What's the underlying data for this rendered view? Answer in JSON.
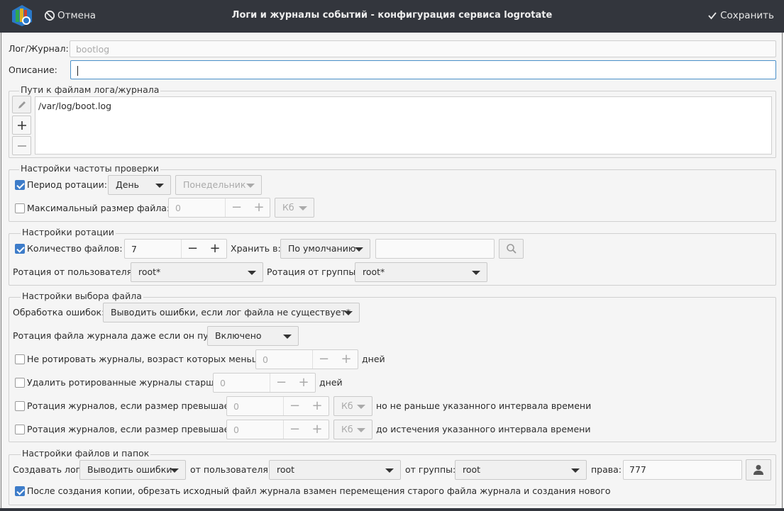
{
  "window": {
    "title": "Логи и журналы событий - конфигурация сервиса logrotate",
    "cancel_label": "Отмена",
    "save_label": "Сохранить"
  },
  "log": {
    "label": "Лог/Журнал:",
    "value": "bootlog",
    "desc_label": "Описание:",
    "desc_value": ""
  },
  "paths": {
    "title": "Пути к файлам лога/журнала",
    "items": [
      "/var/log/boot.log"
    ]
  },
  "freq": {
    "title": "Настройки частоты проверки",
    "period_label": "Период ротации:",
    "period_checked": true,
    "period_value": "День",
    "weekday_value": "Понедельник",
    "maxsize_label": "Максимальный размер файла:",
    "maxsize_checked": false,
    "maxsize_value": "0",
    "maxsize_unit": "Кб"
  },
  "rotation": {
    "title": "Настройки ротации",
    "count_label": "Количество файлов:",
    "count_checked": true,
    "count_value": "7",
    "store_label": "Хранить в:",
    "store_value": "По умолчанию",
    "store_path": "",
    "user_label": "Ротация от пользователя:",
    "user_value": "root*",
    "group_label": "Ротация от группы:",
    "group_value": "root*"
  },
  "select": {
    "title": "Настройки выбора файла",
    "errors_label": "Обработка ошибок:",
    "errors_value": "Выводить ошибки, если лог файла не существует*",
    "empty_label": "Ротация файла журнала даже если он пуст:",
    "empty_value": "Включено",
    "minage_label": "Не ротировать журналы, возраст которых меньше",
    "minage_value": "0",
    "minage_unit": "дней",
    "maxage_label": "Удалить ротированные журналы старше",
    "maxage_value": "0",
    "maxage_unit": "дней",
    "minsize_label": "Ротация журналов, если размер превышает",
    "minsize_value": "0",
    "minsize_unit": "Кб",
    "minsize_suffix": "но не раньше указанного интервала времени",
    "size2_label": "Ротация журналов, если размер превышает",
    "size2_value": "0",
    "size2_unit": "Кб",
    "size2_suffix": "до истечения указанного интервала времени"
  },
  "files": {
    "title": "Настройки файлов и папок",
    "create_label": "Создавать лог",
    "create_value": "Выводить ошибки",
    "user_label": "от пользователя:",
    "user_value": "root",
    "group_label": "от группы:",
    "group_value": "root",
    "perm_label": "права:",
    "perm_value": "777",
    "copytruncate_checked": true,
    "copytruncate_label": "После создания копии, обрезать исходный файл журнала взамен перемещения старого файла журнала и создания нового"
  },
  "icons": {
    "app": "logrotate-app-icon",
    "cancel": "cancel-circle-icon",
    "save": "checkmark-icon",
    "edit": "pencil-icon",
    "add": "plus-icon",
    "remove": "minus-icon",
    "browse": "search-icon",
    "user": "user-icon"
  },
  "colors": {
    "titlebar": "#33363d",
    "accent": "#3d7cc9",
    "focus_border": "#4a90c9"
  }
}
